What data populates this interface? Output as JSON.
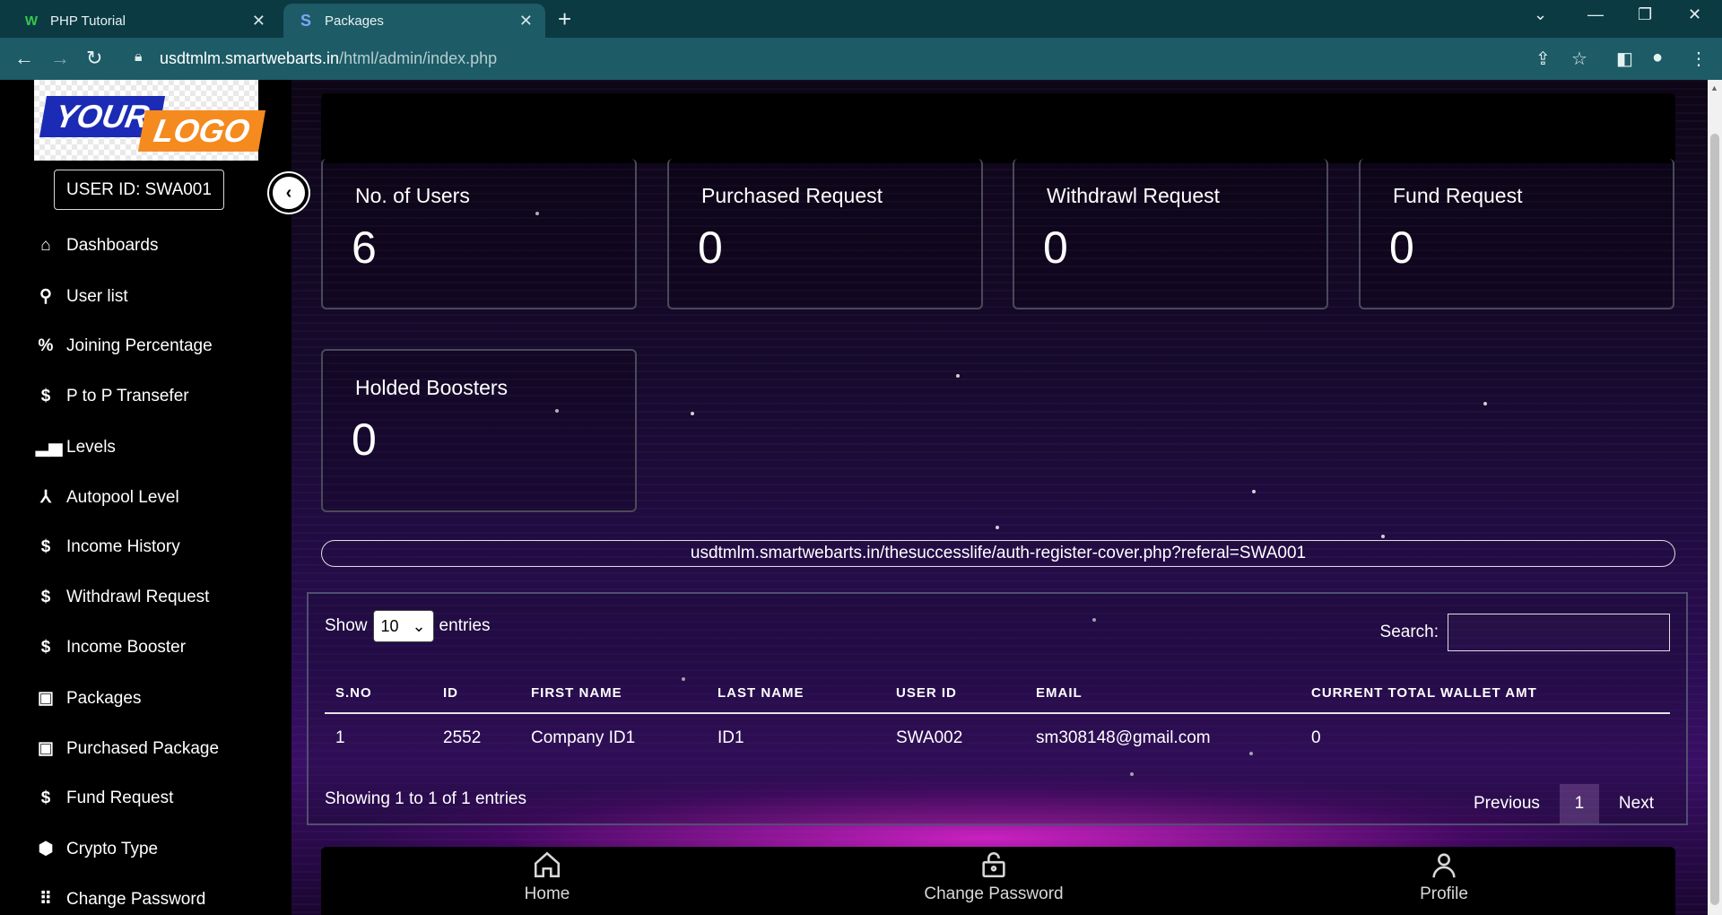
{
  "browser": {
    "tabs": [
      {
        "title": "PHP Tutorial",
        "icon": "w-favicon-icon"
      },
      {
        "title": "Packages",
        "icon": "packages-favicon-icon",
        "active": true
      }
    ],
    "url_host": "usdtmlm.smartwebarts.in",
    "url_path": "/html/admin/index.php"
  },
  "logo": {
    "part1": "YOUR",
    "part2": "LOGO"
  },
  "sidebar": {
    "user_id": "USER ID: SWA001",
    "items": [
      {
        "label": "Dashboards",
        "icon": "home-icon"
      },
      {
        "label": "User list",
        "icon": "user-icon"
      },
      {
        "label": "Joining Percentage",
        "icon": "percent-icon"
      },
      {
        "label": "P to P Transefer",
        "icon": "dollar-icon"
      },
      {
        "label": "Levels",
        "icon": "bar-chart-icon"
      },
      {
        "label": "Autopool Level",
        "icon": "network-icon"
      },
      {
        "label": "Income History",
        "icon": "dollar-icon"
      },
      {
        "label": "Withdrawl Request",
        "icon": "dollar-icon"
      },
      {
        "label": "Income Booster",
        "icon": "dollar-icon"
      },
      {
        "label": "Packages",
        "icon": "briefcase-icon"
      },
      {
        "label": "Purchased Package",
        "icon": "briefcase-icon"
      },
      {
        "label": "Fund Request",
        "icon": "dollar-icon"
      },
      {
        "label": "Crypto Type",
        "icon": "crypto-icon"
      },
      {
        "label": "Change Password",
        "icon": "grid-icon"
      }
    ]
  },
  "cards": [
    {
      "label": "No. of Users",
      "value": "6"
    },
    {
      "label": "Purchased Request",
      "value": "0"
    },
    {
      "label": "Withdrawl Request",
      "value": "0"
    },
    {
      "label": "Fund Request",
      "value": "0"
    },
    {
      "label": "Holded Boosters",
      "value": "0"
    }
  ],
  "referral_link": "usdtmlm.smartwebarts.in/thesuccesslife/auth-register-cover.php?referal=SWA001",
  "table": {
    "show_label": "Show",
    "entries_value": "10",
    "entries_label": "entries",
    "search_label": "Search:",
    "columns": [
      "S.NO",
      "ID",
      "FIRST NAME",
      "LAST NAME",
      "USER ID",
      "EMAIL",
      "CURRENT TOTAL WALLET AMT"
    ],
    "rows": [
      [
        "1",
        "2552",
        "Company ID1",
        "ID1",
        "SWA002",
        "sm308148@gmail.com",
        "0"
      ]
    ],
    "info": "Showing 1 to 1 of 1 entries",
    "prev_label": "Previous",
    "page": "1",
    "next_label": "Next"
  },
  "bottom_nav": [
    {
      "label": "Home",
      "icon": "home-icon"
    },
    {
      "label": "Change Password",
      "icon": "lock-icon"
    },
    {
      "label": "Profile",
      "icon": "profile-icon"
    }
  ],
  "colors": {
    "browser_frame": "#0b3a43",
    "address_bar": "#1d5b66",
    "accent_glow": "#ff28e6",
    "logo_blue": "#1b2bb5",
    "logo_orange": "#f58a1f"
  }
}
